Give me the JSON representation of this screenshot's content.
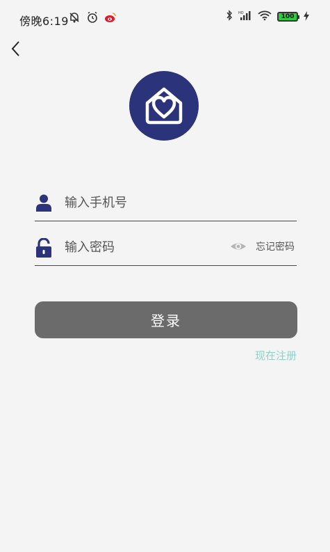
{
  "status_bar": {
    "time": "傍晚6:19",
    "battery": "100"
  },
  "login": {
    "phone_placeholder": "输入手机号",
    "password_placeholder": "输入密码",
    "forgot_label": "忘记密码",
    "login_label": "登录",
    "register_label": "现在注册"
  },
  "icons": {
    "back": "chevron-left-icon",
    "logo": "house-heart-logo",
    "user": "user-icon",
    "lock": "lock-icon",
    "eye": "eye-icon"
  },
  "colors": {
    "brand": "#2b347a",
    "button": "#6b6b6b",
    "link": "#8fd0cb"
  }
}
